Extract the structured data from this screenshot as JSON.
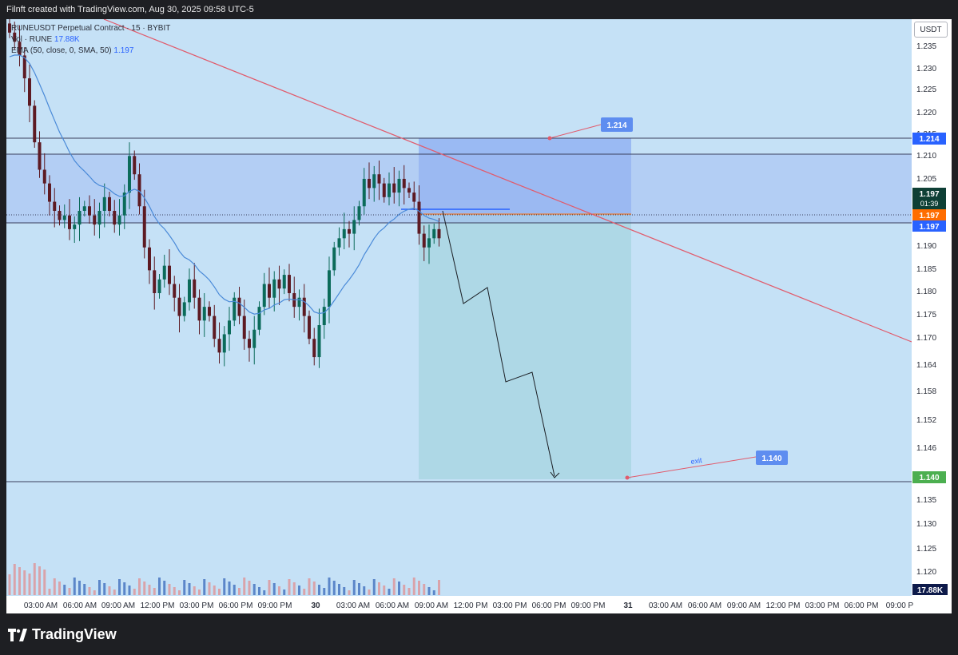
{
  "header": {
    "attribution": "Filnft created with TradingView.com, Aug 30, 2025 09:58 UTC-5"
  },
  "legend": {
    "symbol_line": "RUNEUSDT Perpetual Contract · 15 · BYBIT",
    "vol_label": "Vol · RUNE",
    "vol_value": "17.88K",
    "ema_label": "EMA (50, close, 0, SMA, 50)",
    "ema_value": "1.197"
  },
  "currency": "USDT",
  "price_tags": {
    "target_top": "1.214",
    "current": "1.197",
    "countdown": "01:39",
    "orange": "1.197",
    "blue": "1.197",
    "exit": "1.140",
    "volume": "17.88K"
  },
  "annotations": {
    "top_label": "1.214",
    "exit_text": "exit",
    "exit_label": "1.140"
  },
  "footer": {
    "brand": "TradingView"
  },
  "colors": {
    "chart_bg": "#c5e1f6",
    "candle_up": "#0b6b5a",
    "candle_down": "#5d1a23",
    "ema": "#4a8ad8",
    "trendline": "#e15b6c",
    "tag_blue": "#2962ff",
    "tag_orange": "#ff6d00",
    "tag_green": "#4caf50",
    "tag_dark": "#0e3f35"
  },
  "chart_data": {
    "type": "candlestick",
    "symbol": "RUNEUSDT",
    "interval": "15",
    "exchange": "BYBIT",
    "price_ticks": [
      "1.235",
      "1.230",
      "1.225",
      "1.220",
      "1.215",
      "1.210",
      "1.205",
      "1.200",
      "1.195",
      "1.190",
      "1.185",
      "1.180",
      "1.175",
      "1.170",
      "1.164",
      "1.158",
      "1.152",
      "1.146",
      "1.140",
      "1.135",
      "1.130",
      "1.125",
      "1.120"
    ],
    "time_ticks": [
      "03:00 AM",
      "06:00 AM",
      "09:00 AM",
      "12:00 PM",
      "03:00 PM",
      "06:00 PM",
      "09:00 PM",
      "30",
      "03:00 AM",
      "06:00 AM",
      "09:00 AM",
      "12:00 PM",
      "03:00 PM",
      "06:00 PM",
      "09:00 PM",
      "31",
      "03:00 AM",
      "06:00 AM",
      "09:00 AM",
      "12:00 PM",
      "03:00 PM",
      "06:00 PM",
      "09:00 P"
    ],
    "closes": [
      1.238,
      1.236,
      1.233,
      1.228,
      1.222,
      1.214,
      1.208,
      1.205,
      1.201,
      1.199,
      1.197,
      1.198,
      1.195,
      1.196,
      1.199,
      1.2,
      1.198,
      1.196,
      1.199,
      1.202,
      1.199,
      1.196,
      1.198,
      1.203,
      1.211,
      1.207,
      1.2,
      1.191,
      1.186,
      1.181,
      1.184,
      1.187,
      1.183,
      1.18,
      1.176,
      1.179,
      1.184,
      1.18,
      1.175,
      1.178,
      1.176,
      1.171,
      1.168,
      1.172,
      1.175,
      1.18,
      1.176,
      1.171,
      1.169,
      1.173,
      1.178,
      1.183,
      1.18,
      1.184,
      1.182,
      1.185,
      1.181,
      1.178,
      1.18,
      1.176,
      1.171,
      1.167,
      1.174,
      1.178,
      1.186,
      1.191,
      1.193,
      1.195,
      1.194,
      1.197,
      1.2,
      1.206,
      1.204,
      1.207,
      1.205,
      1.202,
      1.205,
      1.203,
      1.206,
      1.204,
      1.203,
      1.201,
      1.194,
      1.191,
      1.193,
      1.195,
      1.193
    ],
    "ema_50": 1.197,
    "horizontal_levels": [
      1.214,
      1.211,
      1.197,
      1.14
    ],
    "short_position": {
      "entry": 1.197,
      "stop": 1.214,
      "target": 1.14
    },
    "volume_last": "17.88K"
  }
}
